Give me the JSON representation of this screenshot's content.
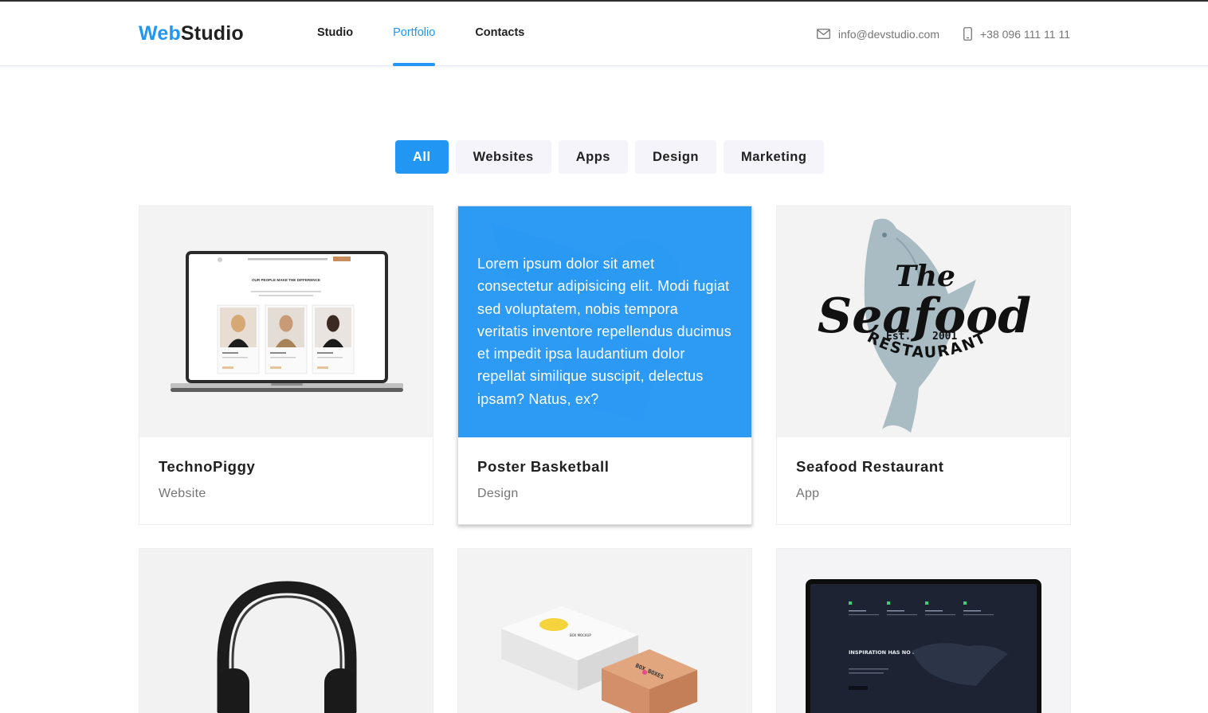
{
  "header": {
    "logo_part1": "Web",
    "logo_part2": "Studio",
    "nav": [
      {
        "label": "Studio"
      },
      {
        "label": "Portfolio"
      },
      {
        "label": "Contacts"
      }
    ],
    "email": "info@devstudio.com",
    "phone": "+38 096 111 11 11"
  },
  "filters": [
    {
      "label": "All"
    },
    {
      "label": "Websites"
    },
    {
      "label": "Apps"
    },
    {
      "label": "Design"
    },
    {
      "label": "Marketing"
    }
  ],
  "portfolio": [
    {
      "title": "TechnoPiggy",
      "type": "Website",
      "preview_heading": "OUR PEOPLE MAKE THE DIFFERENCE",
      "device": "MacBook Pro"
    },
    {
      "title": "Poster Basketball",
      "type": "Design",
      "overlay_text": "Lorem ipsum dolor sit amet consectetur adipisicing elit. Modi fugiat sed voluptatem, nobis tempora veritatis inventore repellendus ducimus et impedit ipsa laudantium dolor repellat similique suscipit, delectus ipsam? Natus, ex?"
    },
    {
      "title": "Seafood Restaurant",
      "type": "App",
      "logo_the": "The",
      "logo_main": "Seafood",
      "logo_est": "Est.",
      "logo_year": "2001",
      "logo_restaurant": "RESTAURANT"
    },
    {
      "title": "",
      "type": ""
    },
    {
      "title": "",
      "type": "",
      "box_text_1": "BOX BOXES",
      "box_text_2": "BOX MOCKUP"
    },
    {
      "title": "",
      "type": "",
      "screen_heading": "INSPIRATION HAS NO BORDERS"
    }
  ],
  "colors": {
    "accent": "#2196f3",
    "text_dark": "#212121",
    "text_muted": "#757575",
    "filter_bg": "#f5f4fa"
  },
  "icons": {
    "email": "envelope-icon",
    "phone": "smartphone-icon"
  }
}
